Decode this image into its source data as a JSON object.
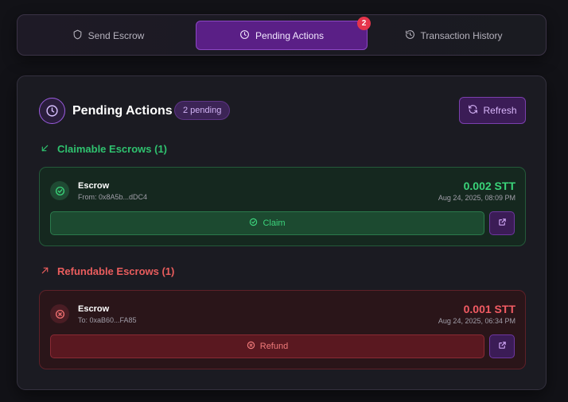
{
  "tabs": [
    {
      "label": "Send Escrow",
      "icon": "shield-icon",
      "active": false
    },
    {
      "label": "Pending Actions",
      "icon": "clock-icon",
      "active": true,
      "badge": "2"
    },
    {
      "label": "Transaction History",
      "icon": "history-icon",
      "active": false
    }
  ],
  "header": {
    "title": "Pending Actions",
    "pending_badge": "2 pending",
    "refresh_label": "Refresh"
  },
  "claimable": {
    "title": "Claimable Escrows (1)",
    "items": [
      {
        "name": "Escrow",
        "address": "From: 0x8A5b...dDC4",
        "amount": "0.002 STT",
        "date": "Aug 24, 2025, 08:09 PM",
        "action_label": "Claim"
      }
    ]
  },
  "refundable": {
    "title": "Refundable Escrows (1)",
    "items": [
      {
        "name": "Escrow",
        "address": "To: 0xaB60...FA85",
        "amount": "0.001 STT",
        "date": "Aug 24, 2025, 06:34 PM",
        "action_label": "Refund"
      }
    ]
  },
  "colors": {
    "accent": "#5a1f86",
    "success": "#3ad57a",
    "danger": "#f25b63",
    "badge": "#e5344b"
  }
}
